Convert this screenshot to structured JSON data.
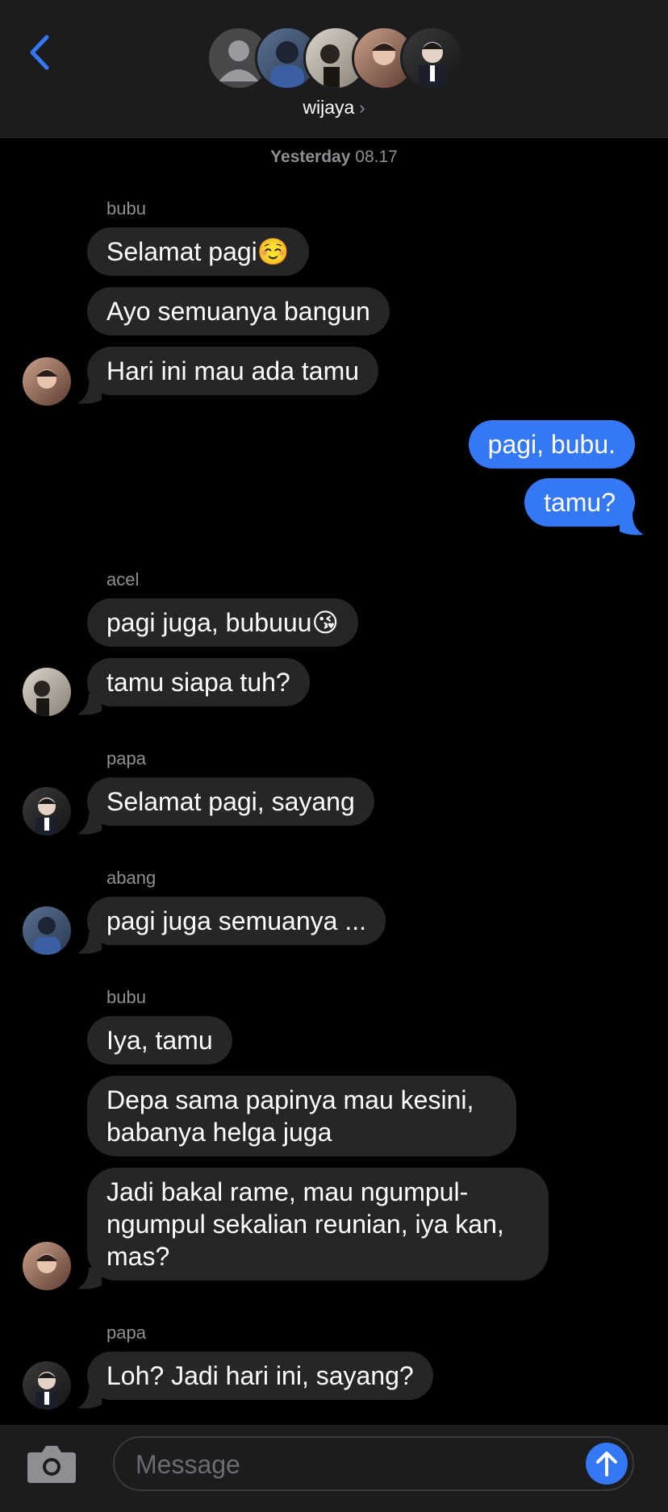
{
  "header": {
    "group_name": "wijaya",
    "chevron": "›",
    "back_icon": "chevron-left-icon"
  },
  "timestamp": {
    "day": "Yesterday",
    "time": "08.17"
  },
  "messages": {
    "s1": "bubu",
    "m1": "Selamat pagi☺️",
    "m2": "Ayo semuanya bangun",
    "m3": "Hari ini mau ada tamu",
    "o1": "pagi, bubu.",
    "o2": "tamu?",
    "s2": "acel",
    "m4": "pagi juga, bubuuu😘",
    "m5": "tamu siapa tuh?",
    "s3": "papa",
    "m6": "Selamat pagi, sayang",
    "s4": "abang",
    "m7": "pagi juga semuanya ...",
    "s5": "bubu",
    "m8": "Iya, tamu",
    "m9": "Depa sama papinya mau kesini, babanya helga juga",
    "m10": "Jadi bakal rame, mau ngumpul-ngumpul sekalian reunian, iya kan, mas?",
    "s6": "papa",
    "m11": "Loh? Jadi hari ini, sayang?"
  },
  "composer": {
    "placeholder": "Message"
  },
  "colors": {
    "accent": "#3478f6",
    "incoming": "#262628",
    "bar": "#1c1c1e"
  }
}
